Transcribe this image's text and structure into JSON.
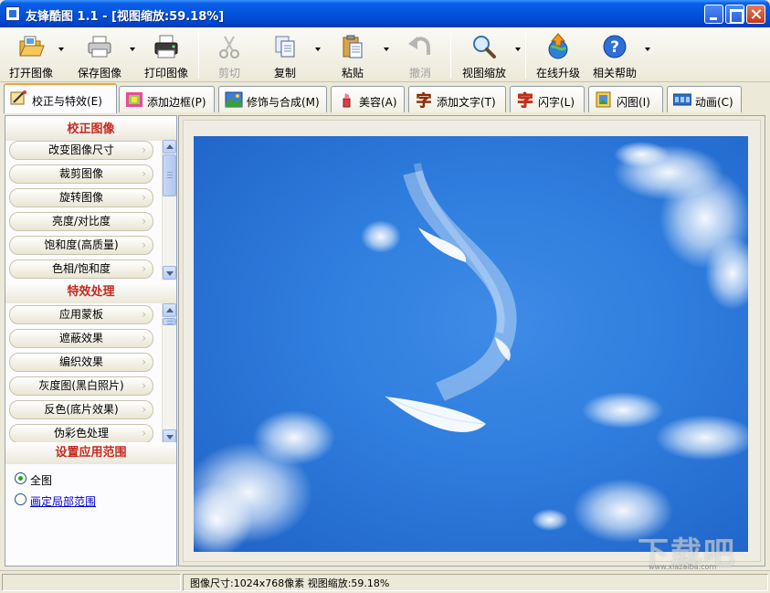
{
  "window": {
    "title": "友锋酷图 1.1 - [视图缩放:59.18%]"
  },
  "toolbar": {
    "open": "打开图像",
    "save": "保存图像",
    "print": "打印图像",
    "cut": "剪切",
    "copy": "复制",
    "paste": "粘贴",
    "undo": "撤消",
    "zoom": "视图缩放",
    "upgrade": "在线升级",
    "help": "相关帮助"
  },
  "tabs": [
    {
      "label": "校正与特效(E)"
    },
    {
      "label": "添加边框(P)"
    },
    {
      "label": "修饰与合成(M)"
    },
    {
      "label": "美容(A)"
    },
    {
      "label": "添加文字(T)"
    },
    {
      "label": "闪字(L)"
    },
    {
      "label": "闪图(I)"
    },
    {
      "label": "动画(C)"
    }
  ],
  "left_panel": {
    "correction": {
      "title": "校正图像",
      "items": [
        "改变图像尺寸",
        "裁剪图像",
        "旋转图像",
        "亮度/对比度",
        "饱和度(高质量)",
        "色相/饱和度"
      ]
    },
    "effects": {
      "title": "特效处理",
      "items": [
        "应用蒙板",
        "遮蔽效果",
        "编织效果",
        "灰度图(黑白照片)",
        "反色(底片效果)",
        "伪彩色处理"
      ]
    },
    "scope": {
      "title": "设置应用范围",
      "options": [
        {
          "label": "全图",
          "checked": true
        },
        {
          "label": "画定局部范围",
          "checked": false
        }
      ]
    }
  },
  "status": {
    "text": "图像尺寸:1024x768像素 视图缩放:59.18%"
  },
  "watermark": {
    "text": "下载吧",
    "url": "www.xiazaiba.com"
  },
  "colors": {
    "title_bar": "#0453DB",
    "section_title": "#C52A1E",
    "sky": "#2E7CDD",
    "active_tab_accent": "#F2A43A"
  }
}
